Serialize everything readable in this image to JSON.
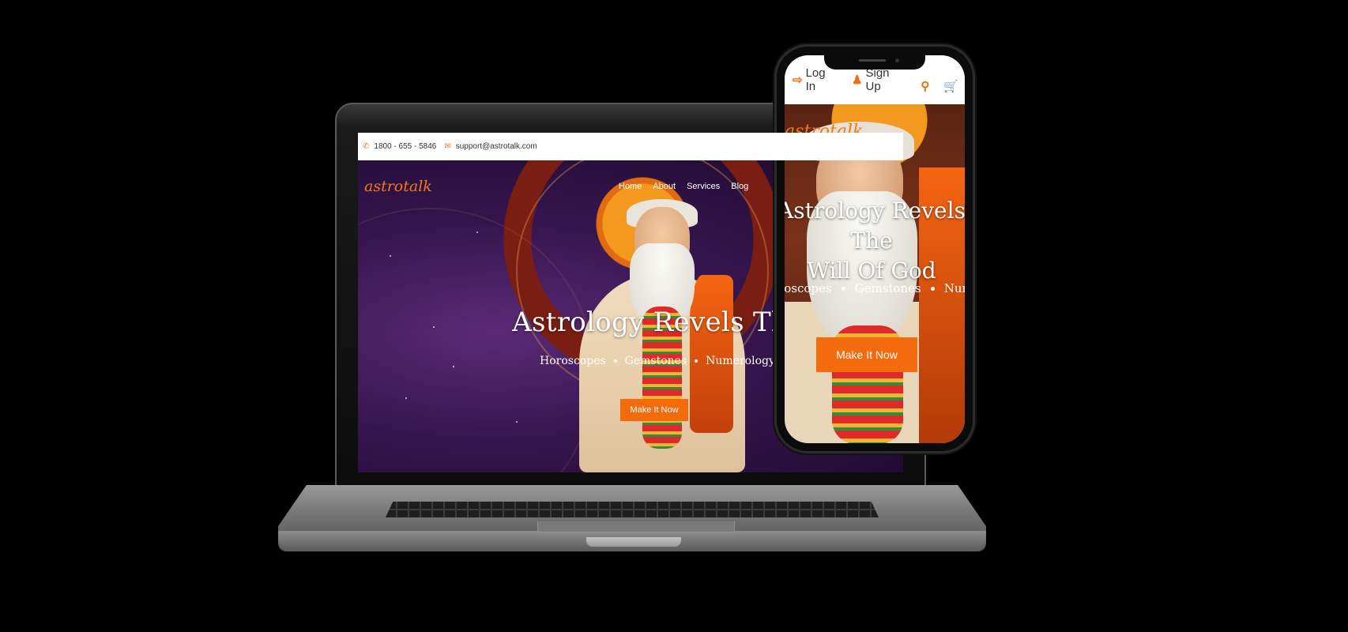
{
  "laptop": {
    "topbar": {
      "phone": "1800 - 655 - 5846",
      "email": "support@astrotalk.com",
      "phone_icon": "phone-icon",
      "email_icon": "envelope-icon"
    },
    "logo": "astrotalk",
    "nav": [
      "Home",
      "About",
      "Services",
      "Blog"
    ],
    "hero": {
      "title": "Astrology Revels The Will",
      "tags": [
        "Horoscopes",
        "Gemstones",
        "Numerology"
      ],
      "button": "Make It Now"
    }
  },
  "phone": {
    "nav": {
      "login": "Log In",
      "signup": "Sign Up",
      "login_icon": "sign-in-icon",
      "signup_icon": "user-plus-icon",
      "search_icon": "search-icon",
      "cart_icon": "cart-icon"
    },
    "logo": "astrotalk",
    "hero": {
      "title_line1": "Astrology Revels The",
      "title_line2": "Will Of God",
      "tags": [
        "Horoscopes",
        "Gemstones",
        "Numerology"
      ],
      "button": "Make It Now"
    }
  },
  "colors": {
    "accent": "#f46b0d",
    "logo": "#f07a1a"
  }
}
